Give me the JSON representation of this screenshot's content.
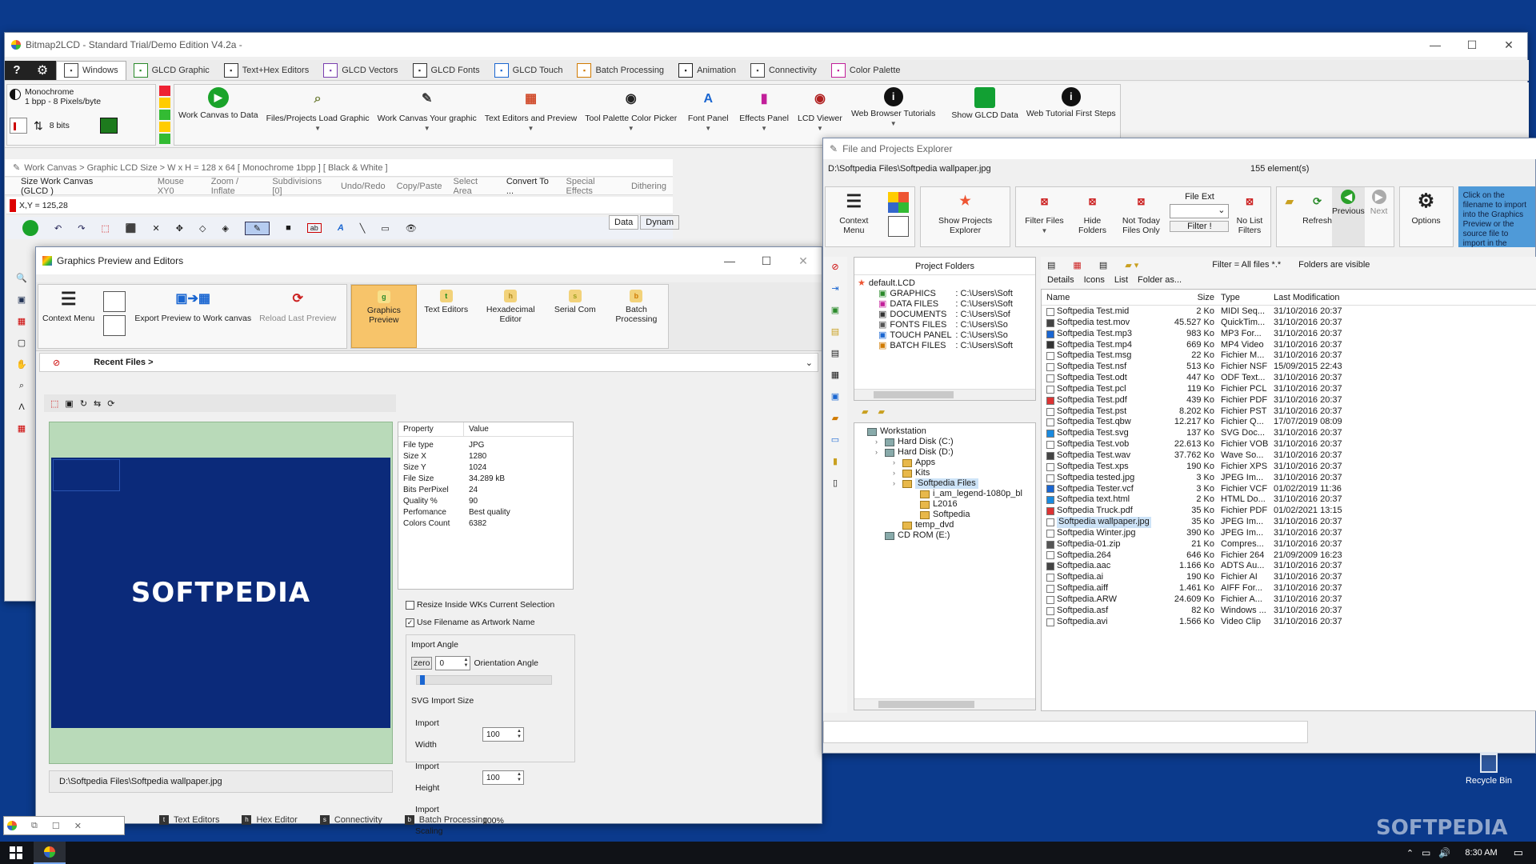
{
  "main_window": {
    "title": "Bitmap2LCD - Standard Trial/Demo Edition V4.2a -",
    "tabs": [
      {
        "label": "Windows",
        "icon": "windows-icon"
      },
      {
        "label": "GLCD Graphic",
        "icon": "image-icon"
      },
      {
        "label": "Text+Hex Editors",
        "icon": "text-icon"
      },
      {
        "label": "GLCD Vectors",
        "icon": "vector-icon"
      },
      {
        "label": "GLCD Fonts",
        "icon": "font-icon"
      },
      {
        "label": "GLCD Touch",
        "icon": "touch-icon"
      },
      {
        "label": "Batch Processing",
        "icon": "batch-icon"
      },
      {
        "label": "Animation",
        "icon": "film-icon"
      },
      {
        "label": "Connectivity",
        "icon": "connectivity-icon"
      },
      {
        "label": "Color Palette",
        "icon": "palette-icon"
      }
    ],
    "mode": {
      "line1": "Monochrome",
      "line2": "1 bpp  - 8 Pixels/byte",
      "bits": "8 bits"
    },
    "ribbon_buttons": [
      {
        "label": "Work Canvas to Data",
        "icon": "play-icon",
        "color": "#1aa32a"
      },
      {
        "label": "Files/Projects Load Graphic",
        "icon": "search-file-icon",
        "color": "#6f7f3a"
      },
      {
        "label": "Work Canvas Your graphic",
        "icon": "pen-icon",
        "color": "#3a3a3a"
      },
      {
        "label": "Text Editors and Preview",
        "icon": "grid-icon",
        "color": "#d04a2a"
      },
      {
        "label": "Tool Palette Color Picker",
        "icon": "palette-icon",
        "color": "#222"
      },
      {
        "label": "Font Panel",
        "icon": "font-a-icon",
        "color": "#1a66d1"
      },
      {
        "label": "Effects Panel",
        "icon": "bars-icon",
        "color": "#c21f9a"
      },
      {
        "label": "LCD Viewer",
        "icon": "eye-icon",
        "color": "#b02020"
      },
      {
        "label": "Web Browser Tutorials",
        "icon": "info-icon",
        "color": "#b01616"
      },
      {
        "label": "Show GLCD Data",
        "icon": "green-box-icon",
        "color": "#12a033"
      },
      {
        "label": "Web Tutorial First Steps",
        "icon": "info-icon",
        "color": "#b01616"
      }
    ],
    "breadcrumb": "Work Canvas >  Graphic LCD Size >  W x H = 128 x 64 [ Monochrome 1bpp ]  [ Black & White ]",
    "canvas_toolbar": [
      "Size Work Canvas (GLCD )",
      "Mouse XY0",
      "Zoom / Inflate",
      "Subdivisions [0]",
      "Undo/Redo",
      "Copy/Paste",
      "Select Area",
      "Convert To ...",
      "Special Effects",
      "Dithering"
    ],
    "coord": "X,Y = 125,28",
    "side_tabs": [
      "Data",
      "Dynam"
    ]
  },
  "preview_window": {
    "title": "Graphics Preview and Editors",
    "ribbon_left": [
      {
        "label": "Context Menu"
      },
      {
        "label": "Export Preview to Work canvas"
      },
      {
        "label": "Reload Last Preview"
      }
    ],
    "ribbon_tabs": [
      {
        "label": "Graphics Preview",
        "letter": "g",
        "active": true
      },
      {
        "label": "Text Editors",
        "letter": "t",
        "active": false
      },
      {
        "label": "Hexadecimal Editor",
        "letter": "h",
        "active": false
      },
      {
        "label": "Serial Com",
        "letter": "s",
        "active": false
      },
      {
        "label": "Batch Processing",
        "letter": "b",
        "active": false
      }
    ],
    "recent_files": "Recent Files >",
    "image_logo": "SOFTPEDIA",
    "path": "D:\\Softpedia Files\\Softpedia wallpaper.jpg",
    "props_header": {
      "property": "Property",
      "value": "Value"
    },
    "props": [
      {
        "k": "File type",
        "v": "JPG"
      },
      {
        "k": "Size X",
        "v": "1280"
      },
      {
        "k": "Size Y",
        "v": "1024"
      },
      {
        "k": "File Size",
        "v": "34.289 kB"
      },
      {
        "k": "Bits PerPixel",
        "v": "24"
      },
      {
        "k": "Quality %",
        "v": "90"
      },
      {
        "k": "Perfomance",
        "v": "Best quality"
      },
      {
        "k": "Colors Count",
        "v": "6382"
      }
    ],
    "resize_label": "Resize Inside WKs Current Selection",
    "resize_checked": false,
    "use_filename_label": "Use Filename as Artwork Name",
    "use_filename_checked": true,
    "import_angle": {
      "title": "Import Angle",
      "zero": "zero",
      "value": "0",
      "label": "Orientation Angle"
    },
    "svg_size": {
      "title": "SVG Import Size",
      "width_label": "Import Width",
      "width": "100",
      "height_label": "Import Height",
      "height": "100",
      "scaling_label": "Import Scaling",
      "scaling": "100%"
    },
    "bottom_tabs": [
      {
        "label": "Text Editors",
        "letter": "t"
      },
      {
        "label": "Hex Editor",
        "letter": "h"
      },
      {
        "label": "Connectivity",
        "letter": "s"
      },
      {
        "label": "Batch Processing",
        "letter": "b"
      }
    ]
  },
  "explorer": {
    "title": "File and Projects Explorer",
    "path": "D:\\Softpedia Files\\Softpedia wallpaper.jpg",
    "count": "155 element(s)",
    "ribbon": [
      {
        "label": "Context Menu"
      },
      {
        "label": "Show Projects Explorer"
      },
      {
        "label": "Filter Files"
      },
      {
        "label": "Hide Folders"
      },
      {
        "label": "Not Today Files Only"
      },
      {
        "label": "No List Filters"
      },
      {
        "label": "Refresh"
      },
      {
        "label": "Previous"
      },
      {
        "label": "Next"
      },
      {
        "label": "Options"
      }
    ],
    "file_ext_label": "File Ext",
    "filter_btn": "Filter !",
    "hint": "Click on the filename to import into the Graphics Preview or the source file to import in the",
    "project_folders_label": "Project Folders",
    "project_tree": [
      {
        "label": "default.LCD",
        "path": ""
      },
      {
        "label": "GRAPHICS",
        "path": ": C:\\Users\\Soft"
      },
      {
        "label": "DATA FILES",
        "path": ": C:\\Users\\Soft"
      },
      {
        "label": "DOCUMENTS",
        "path": ": C:\\Users\\Sof"
      },
      {
        "label": "FONTS FILES",
        "path": ": C:\\Users\\So"
      },
      {
        "label": "TOUCH PANEL",
        "path": ": C:\\Users\\So"
      },
      {
        "label": "BATCH FILES",
        "path": ": C:\\Users\\Soft"
      }
    ],
    "workstation_tree": [
      {
        "label": "Workstation",
        "depth": 0
      },
      {
        "label": "Hard Disk (C:)",
        "depth": 1
      },
      {
        "label": "Hard Disk (D:)",
        "depth": 1
      },
      {
        "label": "Apps",
        "depth": 2
      },
      {
        "label": "Kits",
        "depth": 2
      },
      {
        "label": "Softpedia Files",
        "depth": 2
      },
      {
        "label": "i_am_legend-1080p_bl",
        "depth": 3
      },
      {
        "label": "L2016",
        "depth": 3
      },
      {
        "label": "Softpedia",
        "depth": 3
      },
      {
        "label": "temp_dvd",
        "depth": 2
      },
      {
        "label": "CD ROM (E:)",
        "depth": 1
      }
    ],
    "filter_text": "Filter = All files *.*",
    "folders_visible": "Folders are visible",
    "view_tabs": [
      "Details",
      "Icons",
      "List",
      "Folder as..."
    ],
    "columns": [
      "Name",
      "Size",
      "Type",
      "Last Modification"
    ],
    "files": [
      [
        "Softpedia Test.mid",
        "2 Ko",
        "MIDI Seq...",
        "31/10/2016 20:37"
      ],
      [
        "Softpedia test.mov",
        "45.527 Ko",
        "QuickTim...",
        "31/10/2016 20:37"
      ],
      [
        "Softpedia Test.mp3",
        "983 Ko",
        "MP3 For...",
        "31/10/2016 20:37"
      ],
      [
        "Softpedia Test.mp4",
        "669 Ko",
        "MP4 Video",
        "31/10/2016 20:37"
      ],
      [
        "Softpedia Test.msg",
        "22 Ko",
        "Fichier M...",
        "31/10/2016 20:37"
      ],
      [
        "Softpedia Test.nsf",
        "513 Ko",
        "Fichier NSF",
        "15/09/2015 22:43"
      ],
      [
        "Softpedia Test.odt",
        "447 Ko",
        "ODF Text...",
        "31/10/2016 20:37"
      ],
      [
        "Softpedia Test.pcl",
        "119 Ko",
        "Fichier PCL",
        "31/10/2016 20:37"
      ],
      [
        "Softpedia Test.pdf",
        "439 Ko",
        "Fichier PDF",
        "31/10/2016 20:37"
      ],
      [
        "Softpedia Test.pst",
        "8.202 Ko",
        "Fichier PST",
        "31/10/2016 20:37"
      ],
      [
        "Softpedia Test.qbw",
        "12.217 Ko",
        "Fichier Q...",
        "17/07/2019 08:09"
      ],
      [
        "Softpedia Test.svg",
        "137 Ko",
        "SVG Doc...",
        "31/10/2016 20:37"
      ],
      [
        "Softpedia Test.vob",
        "22.613 Ko",
        "Fichier VOB",
        "31/10/2016 20:37"
      ],
      [
        "Softpedia Test.wav",
        "37.762 Ko",
        "Wave So...",
        "31/10/2016 20:37"
      ],
      [
        "Softpedia Test.xps",
        "190 Ko",
        "Fichier XPS",
        "31/10/2016 20:37"
      ],
      [
        "Softpedia tested.jpg",
        "3 Ko",
        "JPEG Im...",
        "31/10/2016 20:37"
      ],
      [
        "Softpedia Tester.vcf",
        "3 Ko",
        "Fichier VCF",
        "01/02/2019 11:36"
      ],
      [
        "Softpedia text.html",
        "2 Ko",
        "HTML Do...",
        "31/10/2016 20:37"
      ],
      [
        "Softpedia Truck.pdf",
        "35 Ko",
        "Fichier PDF",
        "01/02/2021 13:15"
      ],
      [
        "Softpedia wallpaper.jpg",
        "35 Ko",
        "JPEG Im...",
        "31/10/2016 20:37"
      ],
      [
        "Softpedia Winter.jpg",
        "390 Ko",
        "JPEG Im...",
        "31/10/2016 20:37"
      ],
      [
        "Softpedia-01.zip",
        "21 Ko",
        "Compres...",
        "31/10/2016 20:37"
      ],
      [
        "Softpedia.264",
        "646 Ko",
        "Fichier 264",
        "21/09/2009 16:23"
      ],
      [
        "Softpedia.aac",
        "1.166 Ko",
        "ADTS Au...",
        "31/10/2016 20:37"
      ],
      [
        "Softpedia.ai",
        "190 Ko",
        "Fichier AI",
        "31/10/2016 20:37"
      ],
      [
        "Softpedia.aiff",
        "1.461 Ko",
        "AIFF For...",
        "31/10/2016 20:37"
      ],
      [
        "Softpedia.ARW",
        "24.609 Ko",
        "Fichier A...",
        "31/10/2016 20:37"
      ],
      [
        "Softpedia.asf",
        "82 Ko",
        "Windows ...",
        "31/10/2016 20:37"
      ],
      [
        "Softpedia.avi",
        "1.566 Ko",
        "Video Clip",
        "31/10/2016 20:37"
      ]
    ],
    "selected_file": "Softpedia wallpaper.jpg"
  },
  "desktop": {
    "recycle_bin": "Recycle Bin",
    "watermark": "SOFTPEDIA"
  },
  "taskbar": {
    "time": "8:30 AM"
  },
  "colors": {
    "desktop": "#0b3a8c",
    "preview_bg": "#0b2a7a",
    "preview_frame": "#b9dab9",
    "accent_tab": "#f7c46a"
  }
}
